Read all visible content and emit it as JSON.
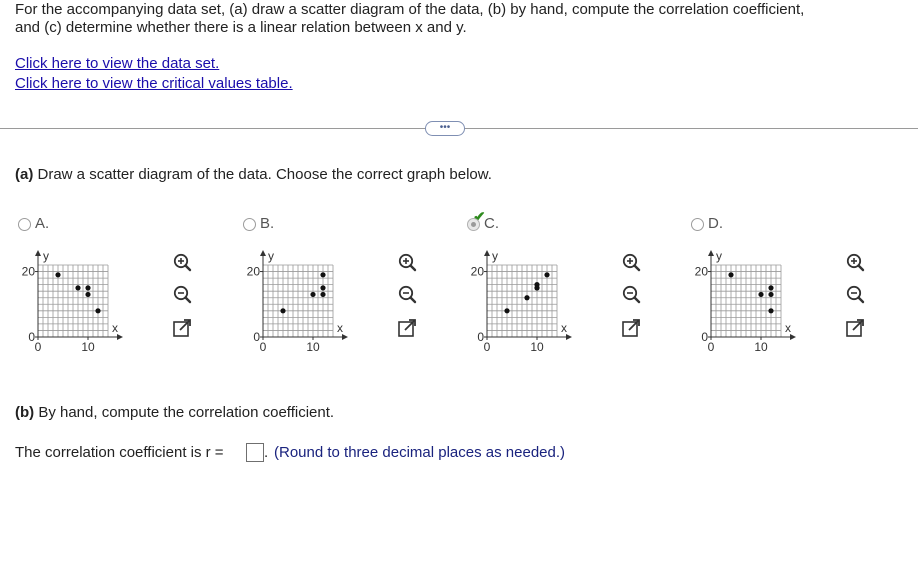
{
  "question": {
    "line1": "For the accompanying data set, (a) draw a scatter diagram of the data, (b) by hand, compute the correlation coefficient,",
    "line2": "and (c) determine whether there is a linear relation between x and y."
  },
  "links": {
    "data_set": "Click here to view the data set.",
    "critical_values": "Click here to view the critical values table."
  },
  "more_button": "•••",
  "part_a": {
    "prefix": "(a)",
    "text": " Draw a scatter diagram of the data. Choose the correct graph below."
  },
  "options": [
    {
      "letter": "A.",
      "selected": false,
      "points": [
        [
          4,
          19
        ],
        [
          8,
          15
        ],
        [
          10,
          15
        ],
        [
          10,
          13
        ],
        [
          12,
          8
        ]
      ]
    },
    {
      "letter": "B.",
      "selected": false,
      "points": [
        [
          4,
          8
        ],
        [
          10,
          13
        ],
        [
          12,
          13
        ],
        [
          12,
          15
        ],
        [
          12,
          19
        ]
      ]
    },
    {
      "letter": "C.",
      "selected": true,
      "points": [
        [
          4,
          8
        ],
        [
          8,
          12
        ],
        [
          10,
          15
        ],
        [
          10,
          16
        ],
        [
          10,
          15
        ],
        [
          12,
          19
        ]
      ]
    },
    {
      "letter": "D.",
      "selected": false,
      "points": [
        [
          4,
          19
        ],
        [
          10,
          13
        ],
        [
          12,
          13
        ],
        [
          12,
          15
        ],
        [
          12,
          8
        ]
      ]
    }
  ],
  "graph": {
    "y_label": "y",
    "x_label": "x",
    "y_tick_top": "20",
    "y_tick_zero": "0",
    "x_tick_zero": "0",
    "x_tick_end": "10",
    "xlim": [
      0,
      14
    ],
    "ylim": [
      0,
      22
    ]
  },
  "part_b": {
    "prefix": "(b)",
    "text": " By hand, compute the correlation coefficient.",
    "answer_prefix": "The correlation coefficient is r =",
    "answer_value": "",
    "hint": "(Round to three decimal places as needed.)"
  },
  "icons": {
    "zoom_in": "zoom-in-icon",
    "zoom_out": "zoom-out-icon",
    "expand": "expand-icon"
  },
  "colors": {
    "link": "#1a0dab",
    "check": "#2e8b1e",
    "hint": "#1a237e"
  }
}
